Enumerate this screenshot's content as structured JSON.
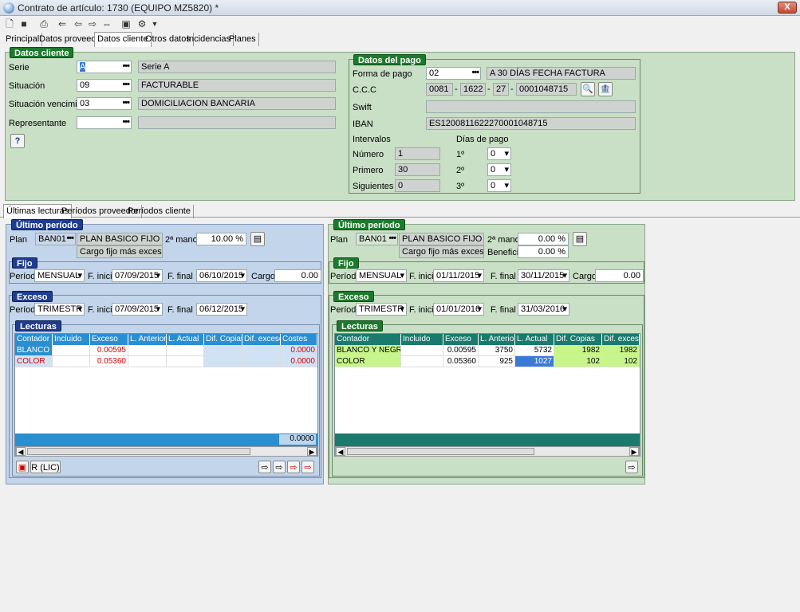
{
  "window": {
    "title": "Contrato de artículo: 1730 (EQUIPO MZ5820) *",
    "close_label": "X"
  },
  "toolbar": {
    "icons": [
      "new-icon",
      "save-icon",
      "print-icon",
      "first-icon",
      "prev-icon",
      "next-icon",
      "last-icon",
      "report-icon",
      "tools-icon"
    ]
  },
  "tabs": [
    "Principal",
    "Datos proveedor",
    "Datos cliente",
    "Otros datos",
    "Incidencias",
    "Planes"
  ],
  "active_tab": "Datos cliente",
  "datos_cliente": {
    "header": "Datos cliente",
    "serie_label": "Serie",
    "serie_code": "A",
    "serie_desc": "Serie A",
    "situacion_label": "Situación",
    "situacion_code": "09",
    "situacion_desc": "FACTURABLE",
    "sit_venc_label": "Situación vencimiento",
    "sit_venc_code": "03",
    "sit_venc_desc": "DOMICILIACION BANCARIA",
    "representante_label": "Representante",
    "representante_code": "",
    "representante_desc": "",
    "dots": "•••"
  },
  "datos_pago": {
    "header": "Datos del pago",
    "forma_label": "Forma de pago",
    "forma_code": "02",
    "forma_desc": "A 30 DÍAS FECHA FACTURA",
    "ccc_label": "C.C.C",
    "ccc_1": "0081",
    "ccc_2": "1622",
    "ccc_3": "27",
    "ccc_4": "0001048715",
    "ccc_sep": "-",
    "swift_label": "Swift",
    "swift_value": "",
    "iban_label": "IBAN",
    "iban_value": "ES1200811622270001048715",
    "intervalos_label": "Intervalos",
    "dias_pago_label": "Días de pago",
    "numero_label": "Número",
    "numero_value": "1",
    "dia1_label": "1º",
    "dia1_value": "0",
    "primero_label": "Primero",
    "primero_value": "30",
    "dia2_label": "2º",
    "dia2_value": "0",
    "siguientes_label": "Siguientes",
    "siguientes_value": "0",
    "dia3_label": "3º",
    "dia3_value": "0"
  },
  "subtabs": [
    "Últimas lecturas",
    "Períodos proveedor",
    "Períodos cliente"
  ],
  "left": {
    "ultimo_header": "Último período",
    "plan_label": "Plan",
    "plan_code": "BAN01",
    "plan_desc": "PLAN BASICO FIJO MAS E)",
    "segunda_label": "2ª mano",
    "segunda_value": "10.00 %",
    "cargo_text": "Cargo fijo más excesos",
    "fijo_header": "Fijo",
    "periodo_label": "Período",
    "fijo_periodo": "MENSUAL",
    "finicio_label": "F. inicio",
    "fijo_inicio": "07/09/2015",
    "ffinal_label": "F. final",
    "fijo_final": "06/10/2015",
    "cargo_label": "Cargo",
    "fijo_cargo": "0.00",
    "exceso_header": "Exceso",
    "exc_periodo": "TRIMESTR",
    "exc_inicio": "07/09/2015",
    "exc_final": "06/12/2015",
    "lecturas_header": "Lecturas",
    "columns": [
      "Contador",
      "Incluido",
      "Exceso",
      "L. Anterior",
      "L. Actual",
      "Dif. Copias",
      "Dif. exceso",
      "Costes"
    ],
    "rows": [
      {
        "contador": "BLANCO ...",
        "incluido": "",
        "exceso": "0.00595",
        "anterior": "",
        "actual": "",
        "dif_copias": "",
        "dif_exceso": "",
        "costes": "0.0000"
      },
      {
        "contador": "COLOR",
        "incluido": "",
        "exceso": "0.05360",
        "anterior": "",
        "actual": "",
        "dif_copias": "",
        "dif_exceso": "",
        "costes": "0.0000"
      }
    ],
    "total": "0.0000",
    "button_rlic": "R (LIC)"
  },
  "right": {
    "ultimo_header": "Último período",
    "plan_label": "Plan",
    "plan_code": "BAN01",
    "plan_desc": "PLAN BASICO FIJO MAS E)",
    "segunda_label": "2ª mano",
    "segunda_value": "0.00 %",
    "cargo_text": "Cargo fijo más excesos",
    "beneficio_label": "Beneficio",
    "beneficio_value": "0.00 %",
    "fijo_header": "Fijo",
    "periodo_label": "Período",
    "fijo_periodo": "MENSUAL",
    "finicio_label": "F. inicio",
    "fijo_inicio": "01/11/2015",
    "ffinal_label": "F. final",
    "fijo_final": "30/11/2015",
    "cargo_label": "Cargo",
    "fijo_cargo": "0.00",
    "exceso_header": "Exceso",
    "exc_periodo": "TRIMESTR",
    "exc_inicio": "01/01/2016",
    "exc_final": "31/03/2016",
    "lecturas_header": "Lecturas",
    "columns": [
      "Contador",
      "Incluido",
      "Exceso",
      "L. Anterior",
      "L. Actual",
      "Dif. Copias",
      "Dif. exceso"
    ],
    "rows": [
      {
        "contador": "BLANCO Y NEGRO",
        "incluido": "",
        "exceso": "0.00595",
        "anterior": "3750",
        "actual": "5732",
        "dif_copias": "1982",
        "dif_exceso": "1982"
      },
      {
        "contador": "COLOR",
        "incluido": "",
        "exceso": "0.05360",
        "anterior": "925",
        "actual": "1027",
        "dif_copias": "102",
        "dif_exceso": "102"
      }
    ]
  },
  "colors": {
    "panel_green": "#c9dfc6",
    "panel_blue": "#c3d5ea",
    "header_green": "#1d7a2c",
    "header_blue": "#1f3c8f",
    "grid_head_blue": "#2a8fd0",
    "grid_head_teal": "#1a7a6e",
    "red_text": "#d40000",
    "highlight_green": "#c8f58a"
  }
}
